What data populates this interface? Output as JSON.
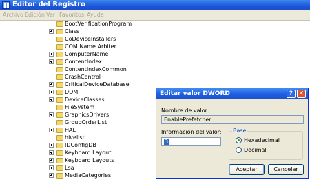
{
  "window": {
    "title": "Editor del Registro"
  },
  "menu": [
    "Archivo",
    "Edición",
    "Ver",
    "Favoritos",
    "Ayuda"
  ],
  "tree": [
    {
      "label": "BootVerificationProgram",
      "expandable": false
    },
    {
      "label": "Class",
      "expandable": true
    },
    {
      "label": "CoDeviceInstallers",
      "expandable": false
    },
    {
      "label": "COM Name Arbiter",
      "expandable": false
    },
    {
      "label": "ComputerName",
      "expandable": true
    },
    {
      "label": "ContentIndex",
      "expandable": true
    },
    {
      "label": "ContentIndexCommon",
      "expandable": false
    },
    {
      "label": "CrashControl",
      "expandable": false
    },
    {
      "label": "CriticalDeviceDatabase",
      "expandable": true
    },
    {
      "label": "DDM",
      "expandable": true
    },
    {
      "label": "DeviceClasses",
      "expandable": true
    },
    {
      "label": "FileSystem",
      "expandable": false
    },
    {
      "label": "GraphicsDrivers",
      "expandable": true
    },
    {
      "label": "GroupOrderList",
      "expandable": false
    },
    {
      "label": "HAL",
      "expandable": true
    },
    {
      "label": "hivelist",
      "expandable": false
    },
    {
      "label": "IDConfigDB",
      "expandable": true
    },
    {
      "label": "Keyboard Layout",
      "expandable": true
    },
    {
      "label": "Keyboard Layouts",
      "expandable": true
    },
    {
      "label": "Lsa",
      "expandable": true
    },
    {
      "label": "MediaCategories",
      "expandable": true
    }
  ],
  "dialog": {
    "title": "Editar valor DWORD",
    "help_glyph": "?",
    "close_glyph": "✕",
    "name_label": "Nombre de valor:",
    "name_value": "EnablePrefetcher",
    "data_label": "Información del valor:",
    "data_value": "3",
    "base_label": "Base",
    "radio_hex": "Hexadecimal",
    "radio_dec": "Decimal",
    "selected_base": "Hexadecimal",
    "accept": "Aceptar",
    "cancel": "Cancelar"
  }
}
